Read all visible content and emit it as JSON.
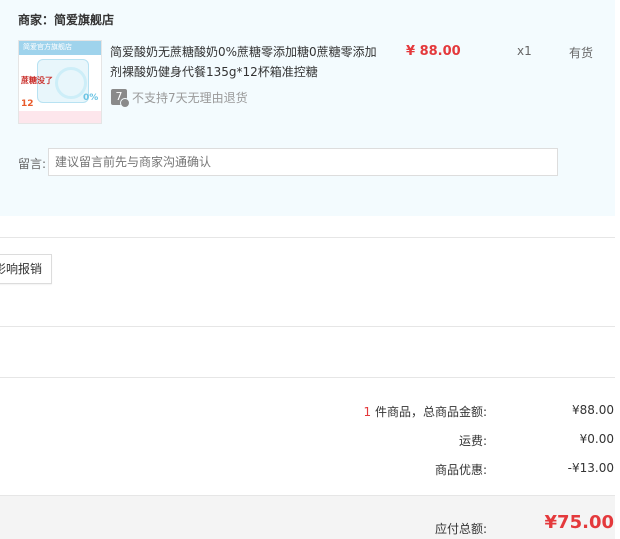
{
  "shop": {
    "label": "商家：简爱旗舰店"
  },
  "product": {
    "image_band_text": "简爱官方旗舰店",
    "image_red_text": "蔗糖没了",
    "image_red_num": "12",
    "image_pct": "0%",
    "title": "简爱酸奶无蔗糖酸奶0%蔗糖零添加糖0蔗糖零添加剂裸酸奶健身代餐135g*12杯箱准控糖",
    "return_icon_text": "7",
    "return_policy": "不支持7天无理由退货",
    "price": "¥ 88.00",
    "quantity": "x1",
    "stock": "有货"
  },
  "message": {
    "label": "留言:",
    "placeholder": "建议留言前先与商家沟通确认"
  },
  "invoice_button_label": "影响报销",
  "summary": {
    "count": "1",
    "items_label": " 件商品，总商品金额:",
    "items_value": "¥88.00",
    "shipping_label": "运费:",
    "shipping_value": "¥0.00",
    "discount_label": "商品优惠:",
    "discount_value": "-¥13.00"
  },
  "total": {
    "label": "应付总额:",
    "value": "¥75.00"
  },
  "colors": {
    "accent_red": "#e4393c",
    "shop_bg": "#f3fbfe"
  }
}
